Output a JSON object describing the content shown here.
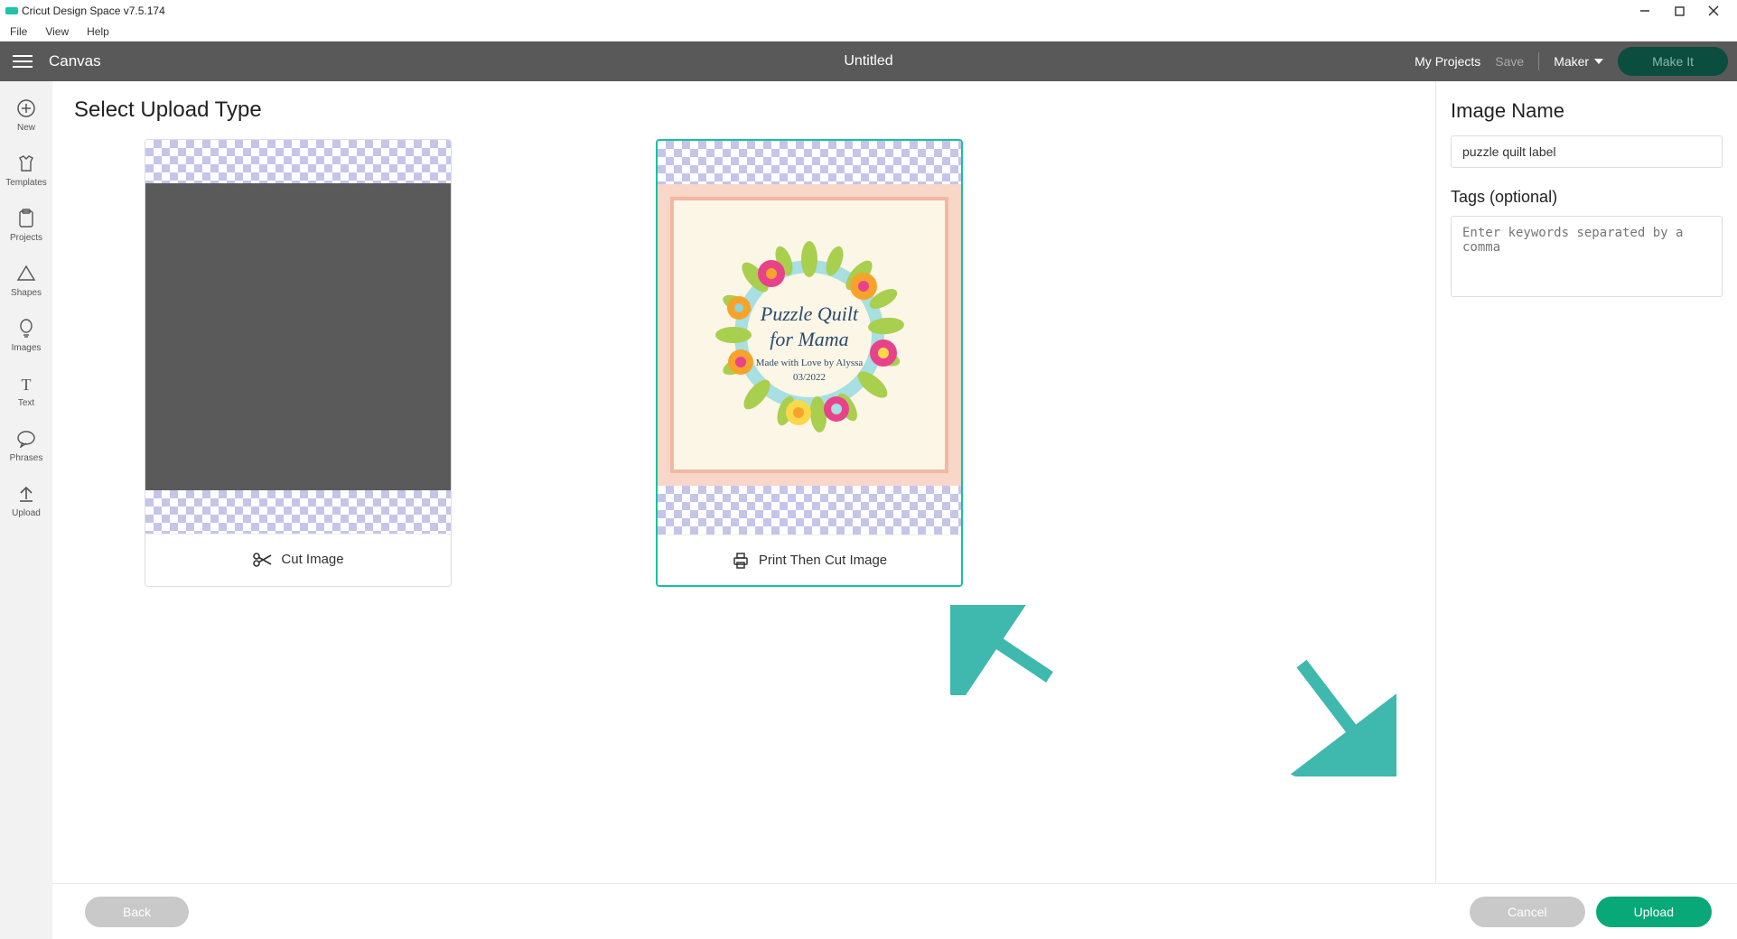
{
  "app": {
    "title": "Cricut Design Space  v7.5.174"
  },
  "menu": {
    "file": "File",
    "view": "View",
    "help": "Help"
  },
  "topbar": {
    "canvas": "Canvas",
    "doc_title": "Untitled",
    "my_projects": "My Projects",
    "save": "Save",
    "machine": "Maker",
    "make_it": "Make It"
  },
  "leftbar": {
    "new": "New",
    "templates": "Templates",
    "projects": "Projects",
    "shapes": "Shapes",
    "images": "Images",
    "text": "Text",
    "phrases": "Phrases",
    "upload": "Upload"
  },
  "main": {
    "heading": "Select Upload Type",
    "cut_image": "Cut Image",
    "print_cut": "Print Then Cut Image",
    "label_line1": "Puzzle Quilt",
    "label_line2": "for Mama",
    "label_line3": "Made with Love by Alyssa",
    "label_line4": "03/2022"
  },
  "panel": {
    "name_label": "Image Name",
    "name_value": "puzzle quilt label",
    "tags_label": "Tags (optional)",
    "tags_placeholder": "Enter keywords separated by a comma"
  },
  "footer": {
    "back": "Back",
    "cancel": "Cancel",
    "upload": "Upload"
  }
}
